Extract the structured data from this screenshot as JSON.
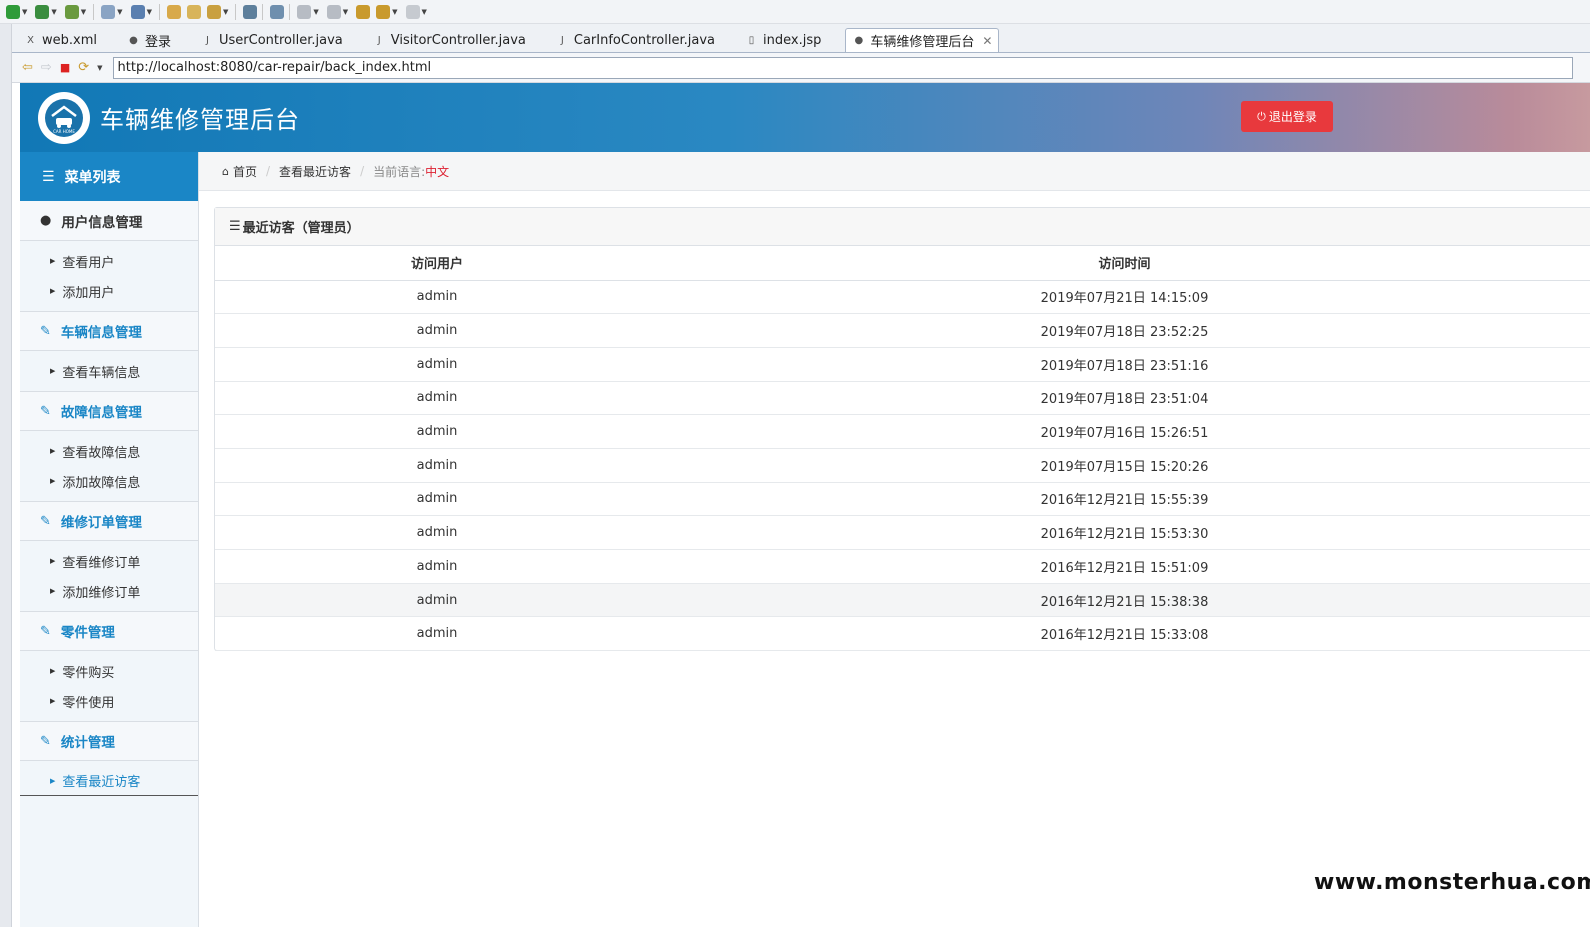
{
  "ide": {
    "tabs": [
      {
        "label": "web.xml",
        "icon": "xml-file-icon"
      },
      {
        "label": "登录",
        "icon": "globe-icon"
      },
      {
        "label": "UserController.java",
        "icon": "java-file-icon"
      },
      {
        "label": "VisitorController.java",
        "icon": "java-file-icon"
      },
      {
        "label": "CarInfoController.java",
        "icon": "java-file-icon"
      },
      {
        "label": "index.jsp",
        "icon": "jsp-file-icon"
      },
      {
        "label": "车辆维修管理后台",
        "icon": "globe-icon",
        "active": true
      }
    ],
    "url": "http://localhost:8080/car-repair/back_index.html"
  },
  "header": {
    "title": "车辆维修管理后台",
    "logout_label": "退出登录",
    "logo_text": "CAR HOME",
    "accent": "#1a86c6",
    "logout_color": "#e8393d"
  },
  "sidebar": {
    "menu_title": "菜单列表",
    "groups": [
      {
        "label": "用户信息管理",
        "icon": "user-icon",
        "items": [
          "查看用户",
          "添加用户"
        ]
      },
      {
        "label": "车辆信息管理",
        "icon": "edit-icon",
        "items": [
          "查看车辆信息"
        ]
      },
      {
        "label": "故障信息管理",
        "icon": "edit-icon",
        "items": [
          "查看故障信息",
          "添加故障信息"
        ]
      },
      {
        "label": "维修订单管理",
        "icon": "edit-icon",
        "items": [
          "查看维修订单",
          "添加维修订单"
        ]
      },
      {
        "label": "零件管理",
        "icon": "edit-icon",
        "items": [
          "零件购买",
          "零件使用"
        ]
      },
      {
        "label": "统计管理",
        "icon": "edit-icon",
        "items": [
          "查看最近访客"
        ]
      }
    ]
  },
  "breadcrumb": {
    "home": "首页",
    "current": "查看最近访客",
    "lang_label": "当前语言:",
    "lang_value": "中文"
  },
  "panel": {
    "title": "最近访客（管理员）",
    "columns": [
      "访问用户",
      "访问时间"
    ],
    "rows": [
      [
        "admin",
        "2019年07月21日 14:15:09"
      ],
      [
        "admin",
        "2019年07月18日 23:52:25"
      ],
      [
        "admin",
        "2019年07月18日 23:51:16"
      ],
      [
        "admin",
        "2019年07月18日 23:51:04"
      ],
      [
        "admin",
        "2019年07月16日 15:26:51"
      ],
      [
        "admin",
        "2019年07月15日 15:20:26"
      ],
      [
        "admin",
        "2016年12月21日 15:55:39"
      ],
      [
        "admin",
        "2016年12月21日 15:53:30"
      ],
      [
        "admin",
        "2016年12月21日 15:51:09"
      ],
      [
        "admin",
        "2016年12月21日 15:38:38"
      ],
      [
        "admin",
        "2016年12月21日 15:33:08"
      ]
    ]
  },
  "watermark": "www.monsterhua.com"
}
